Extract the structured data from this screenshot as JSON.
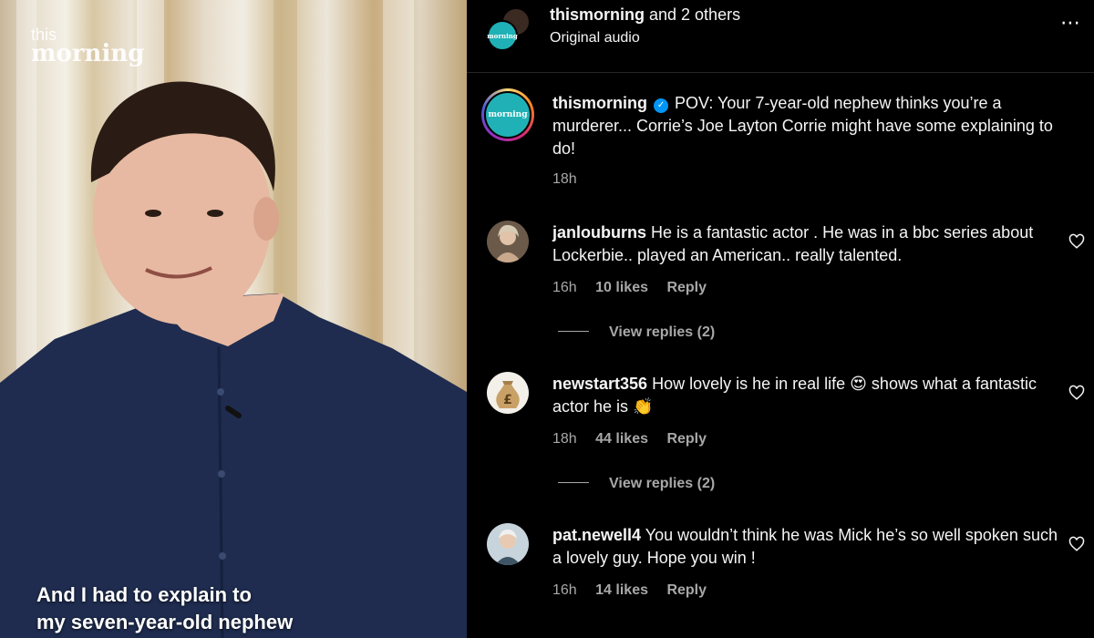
{
  "video": {
    "logo_line1": "this",
    "logo_line2": "morning",
    "caption_line1": "And I had to explain to",
    "caption_line2": "my seven-year-old nephew"
  },
  "header": {
    "account": "thismorning",
    "collab_suffix": " and 2 others",
    "audio": "Original audio",
    "more_icon": "⋯"
  },
  "post": {
    "username": "thismorning",
    "avatar_text": "this morning",
    "caption": "POV: Your 7-year-old nephew thinks you’re a murderer... Corrie’s Joe Layton Corrie might have some explaining to do!",
    "time": "18h"
  },
  "comments": [
    {
      "username": "janlouburns",
      "text": "He is a fantastic actor . He was in a bbc series about Lockerbie.. played an American.. really talented.",
      "time": "16h",
      "likes": "10 likes",
      "reply": "Reply",
      "view_replies": "View replies (2)"
    },
    {
      "username": "newstart356",
      "text": "How lovely is he in real life 😍 shows what a fantastic actor he is 👏",
      "time": "18h",
      "likes": "44 likes",
      "reply": "Reply",
      "view_replies": "View replies (2)"
    },
    {
      "username": "pat.newell4",
      "text": "You wouldn’t think he was Mick he’s so well spoken such a lovely guy. Hope you win !",
      "time": "16h",
      "likes": "14 likes",
      "reply": "Reply"
    }
  ],
  "colors": {
    "background": "#000000",
    "text": "#f5f5f5",
    "muted": "#a8a8a8",
    "verified": "#0095f6",
    "brand_teal": "#1fb1b5"
  }
}
